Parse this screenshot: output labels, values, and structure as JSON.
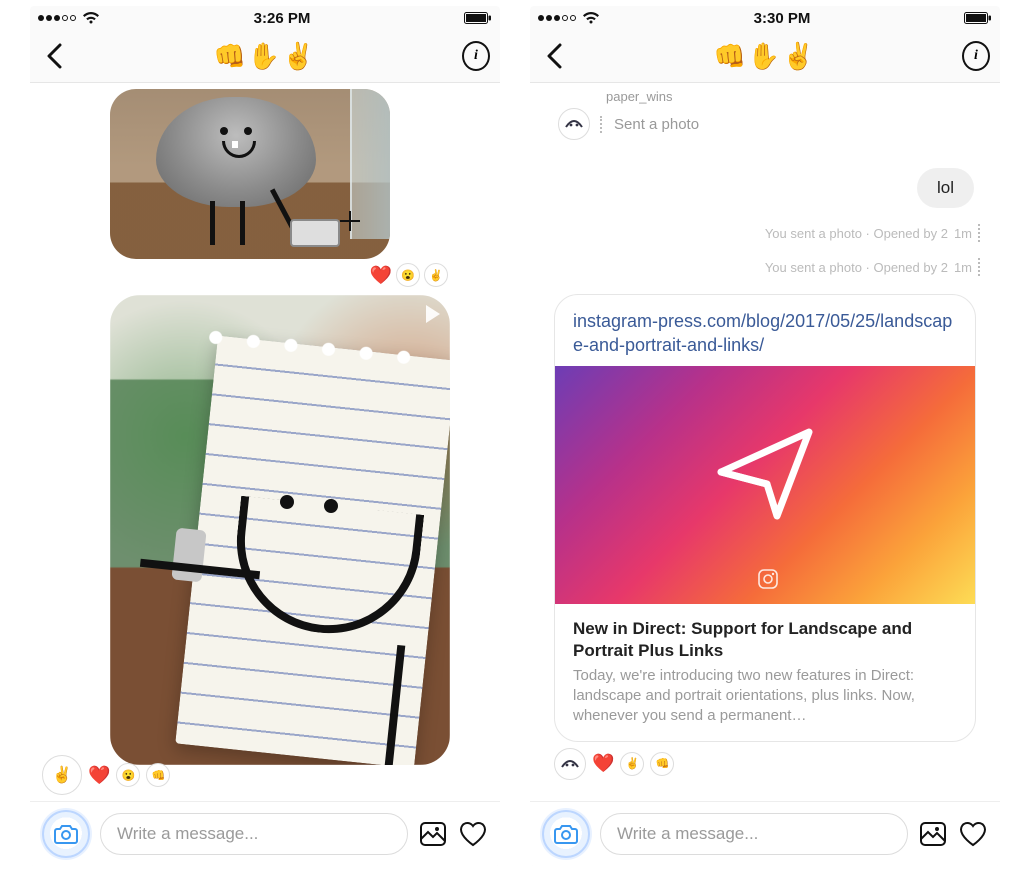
{
  "left": {
    "status": {
      "time": "3:26 PM"
    },
    "nav": {
      "title": "👊✋✌️"
    },
    "reactions_top": {
      "heart": "❤️"
    },
    "composer": {
      "placeholder": "Write a message..."
    }
  },
  "right": {
    "status": {
      "time": "3:30 PM"
    },
    "nav": {
      "title": "👊✋✌️"
    },
    "thread": {
      "username": "paper_wins",
      "sent_photo_label": "Sent a photo",
      "reply_text": "lol",
      "status1": "You sent a photo · Opened by 2",
      "status1_time": "1m",
      "status2": "You sent a photo · Opened by 2",
      "status2_time": "1m"
    },
    "link": {
      "url": "instagram-press.com/blog/2017/05/25/landscape-and-portrait-and-links/",
      "title": "New in Direct: Support for Landscape and Portrait Plus Links",
      "desc": "Today, we're introducing two new features in Direct: landscape and portrait orientations, plus links. Now, whenever you send a permanent…"
    },
    "composer": {
      "placeholder": "Write a message..."
    }
  }
}
